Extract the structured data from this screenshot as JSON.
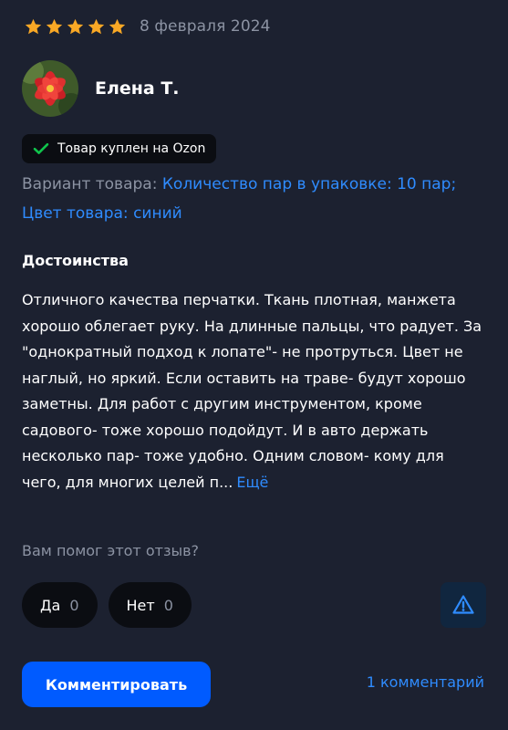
{
  "review": {
    "rating": 5,
    "date": "8 февраля 2024",
    "author": "Елена Т.",
    "badge": "Товар куплен на Ozon",
    "variant_label": "Вариант товара:",
    "variant_value": "Количество пар в упаковке: 10 пар; Цвет товара: синий",
    "section_title": "Достоинства",
    "text": "Отличного качества перчатки. Ткань плотная, манжета хорошо облегает руку. На длинные пальцы, что радует. За \"однократный подход к лопате\"- не протруться. Цвет не наглый, но яркий. Если оставить на траве- будут хорошо заметны. Для работ с другим инструментом, кроме садового- тоже хорошо подойдут. И в авто держать несколько пар- тоже удобно. Одним словом- кому для чего, для многих целей п...",
    "more_label": "Ещё"
  },
  "helpful": {
    "question": "Вам помог этот отзыв?",
    "yes_label": "Да",
    "yes_count": "0",
    "no_label": "Нет",
    "no_count": "0"
  },
  "actions": {
    "comment_button": "Комментировать",
    "comments_link": "1 комментарий"
  },
  "icons": {
    "star": "star-icon",
    "check": "check-icon",
    "report": "warning-triangle-icon",
    "avatar": "red-flower-photo"
  },
  "colors": {
    "background": "#1c2130",
    "star": "#f9a825",
    "accent": "#005bff",
    "link": "#2f8cff",
    "check": "#10c44c",
    "muted": "#8c93a3"
  }
}
